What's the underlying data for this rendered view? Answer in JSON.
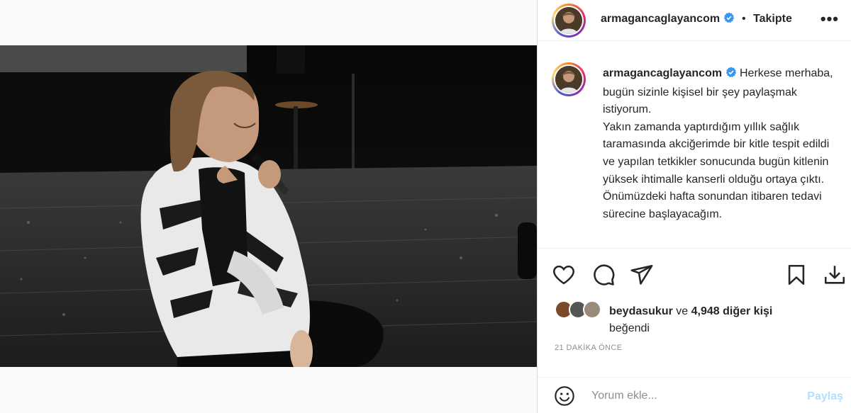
{
  "post": {
    "image_alt": "",
    "header": {
      "username": "armagancaglayancom",
      "separator": "•",
      "follow_status": "Takipte",
      "more": "•••"
    },
    "caption": {
      "username": "armagancaglayancom",
      "text": "Herkese merhaba, bugün sizinle kişisel bir şey paylaşmak istiyorum.\nYakın zamanda yaptırdığım yıllık sağlık taramasında akciğerimde bir kitle tespit edildi ve yapılan tetkikler sonucunda bugün kitlenin yüksek ihtimalle kanserli olduğu ortaya çıktı.\nÖnümüzdeki hafta sonundan itibaren tedavi sürecine başlayacağım."
    },
    "actions": {
      "like_icon": "heart-icon",
      "comment_icon": "comment-icon",
      "share_icon": "send-icon",
      "save_icon": "bookmark-icon",
      "download_icon": "download-icon"
    },
    "likes": {
      "first_liker": "beydasukur",
      "connector": "ve",
      "others_count": "4,948 diğer kişi",
      "suffix": "beğendi"
    },
    "timestamp": "21 DAKİKA ÖNCE",
    "comment": {
      "placeholder": "Yorum ekle...",
      "post_label": "Paylaş",
      "emoji_icon": "smiley-icon"
    },
    "colors": {
      "verified_blue": "#3897f0",
      "post_button_disabled": "#b2dffc",
      "muted_text": "#8e8e8e"
    }
  }
}
